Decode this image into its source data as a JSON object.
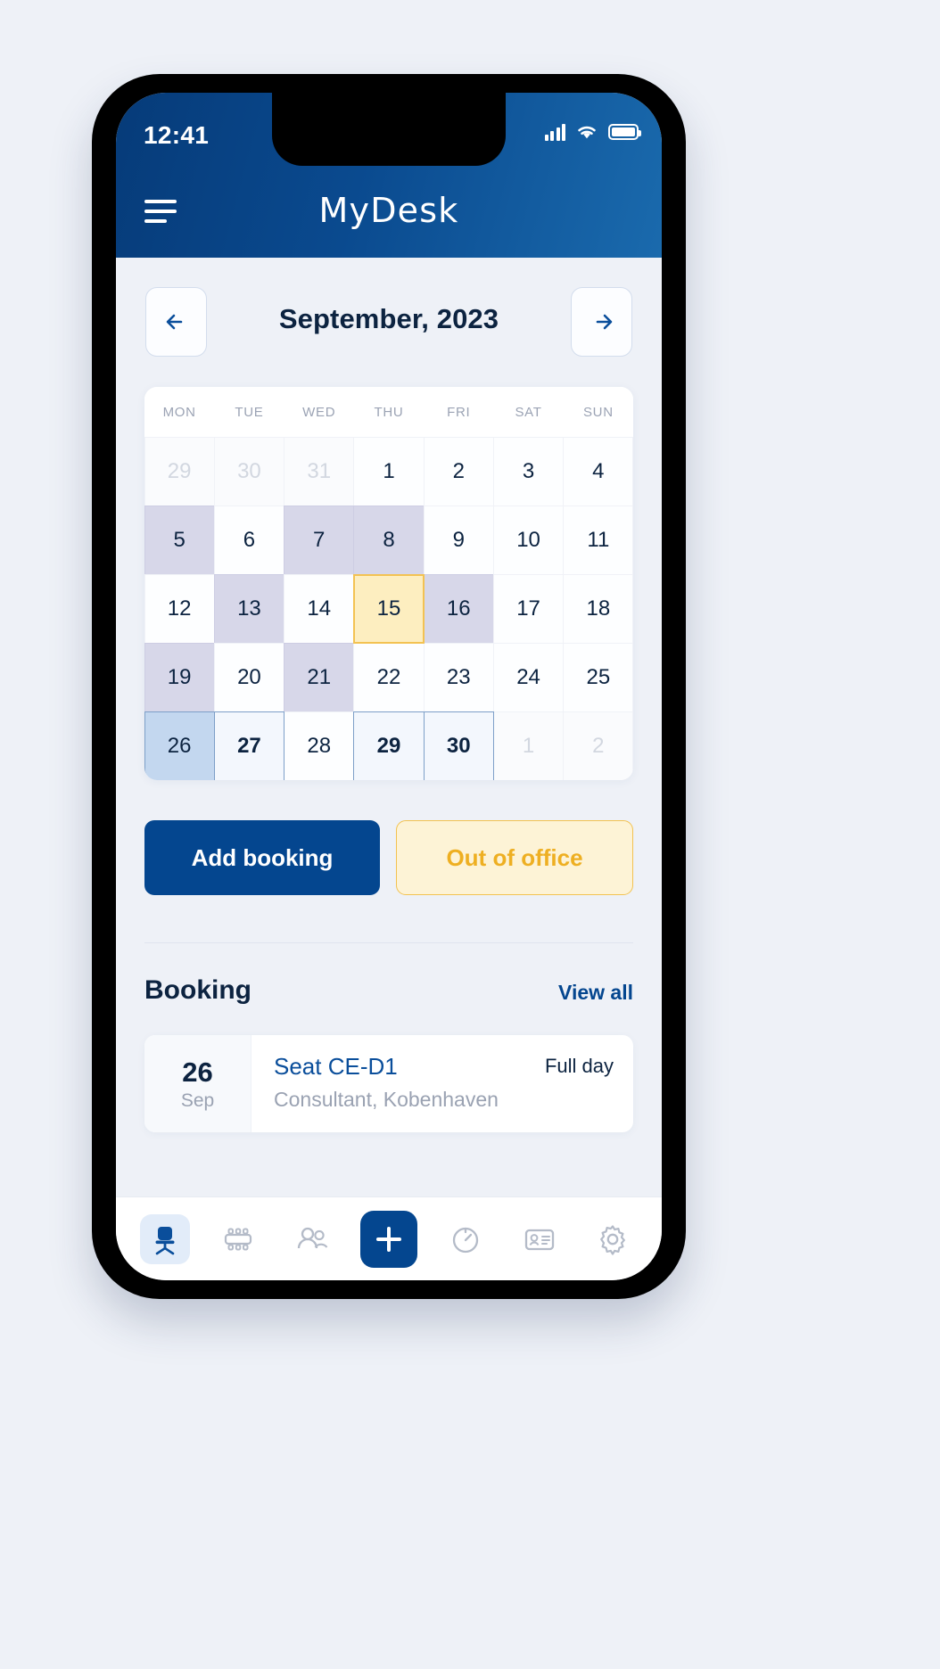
{
  "status_bar": {
    "time": "12:41",
    "icons": [
      "signal-icon",
      "wifi-icon",
      "battery-icon"
    ]
  },
  "header": {
    "menu_icon": "hamburger-menu-icon",
    "logo": "MyDesk"
  },
  "calendar": {
    "prev_icon": "arrow-left-icon",
    "next_icon": "arrow-right-icon",
    "month_title": "September, 2023",
    "weekdays": [
      "MON",
      "TUE",
      "WED",
      "THU",
      "FRI",
      "SAT",
      "SUN"
    ],
    "weeks": [
      [
        {
          "n": "29",
          "state": "muted"
        },
        {
          "n": "30",
          "state": "muted"
        },
        {
          "n": "31",
          "state": "muted"
        },
        {
          "n": "1",
          "state": "normal"
        },
        {
          "n": "2",
          "state": "normal"
        },
        {
          "n": "3",
          "state": "normal"
        },
        {
          "n": "4",
          "state": "normal"
        }
      ],
      [
        {
          "n": "5",
          "state": "lavender"
        },
        {
          "n": "6",
          "state": "normal"
        },
        {
          "n": "7",
          "state": "lavender"
        },
        {
          "n": "8",
          "state": "lavender"
        },
        {
          "n": "9",
          "state": "normal"
        },
        {
          "n": "10",
          "state": "normal"
        },
        {
          "n": "11",
          "state": "normal"
        }
      ],
      [
        {
          "n": "12",
          "state": "normal"
        },
        {
          "n": "13",
          "state": "lavender"
        },
        {
          "n": "14",
          "state": "normal"
        },
        {
          "n": "15",
          "state": "today"
        },
        {
          "n": "16",
          "state": "lavender"
        },
        {
          "n": "17",
          "state": "normal"
        },
        {
          "n": "18",
          "state": "normal"
        }
      ],
      [
        {
          "n": "19",
          "state": "lavender"
        },
        {
          "n": "20",
          "state": "normal"
        },
        {
          "n": "21",
          "state": "lavender"
        },
        {
          "n": "22",
          "state": "normal"
        },
        {
          "n": "23",
          "state": "normal"
        },
        {
          "n": "24",
          "state": "normal"
        },
        {
          "n": "25",
          "state": "normal"
        }
      ],
      [
        {
          "n": "26",
          "state": "bluefill"
        },
        {
          "n": "27",
          "state": "blueoutline"
        },
        {
          "n": "28",
          "state": "normal"
        },
        {
          "n": "29",
          "state": "blueoutline"
        },
        {
          "n": "30",
          "state": "blueoutline"
        },
        {
          "n": "1",
          "state": "muted"
        },
        {
          "n": "2",
          "state": "muted"
        }
      ]
    ]
  },
  "actions": {
    "add_booking": "Add booking",
    "out_of_office": "Out of office"
  },
  "booking_section": {
    "title": "Booking",
    "view_all": "View all",
    "card": {
      "day": "26",
      "month": "Sep",
      "seat": "Seat CE-D1",
      "subtitle": "Consultant, Kobenhaven",
      "duration": "Full day"
    }
  },
  "bottom_nav": {
    "items": [
      {
        "icon": "office-chair-icon",
        "active": true
      },
      {
        "icon": "meeting-room-icon",
        "active": false
      },
      {
        "icon": "people-icon",
        "active": false
      },
      {
        "icon": "plus-icon",
        "active": false
      },
      {
        "icon": "stopwatch-icon",
        "active": false
      },
      {
        "icon": "id-badge-icon",
        "active": false
      },
      {
        "icon": "gear-icon",
        "active": false
      }
    ]
  },
  "colors": {
    "brand_blue": "#04468f",
    "header_gradient_start": "#063b79",
    "header_gradient_end": "#1a6aad",
    "accent_amber": "#eeaf22",
    "lavender_cell": "#d7d7e9",
    "today_cell": "#fdeec0",
    "selected_cell": "#c3d7ef",
    "page_bg": "#eef1f7"
  }
}
